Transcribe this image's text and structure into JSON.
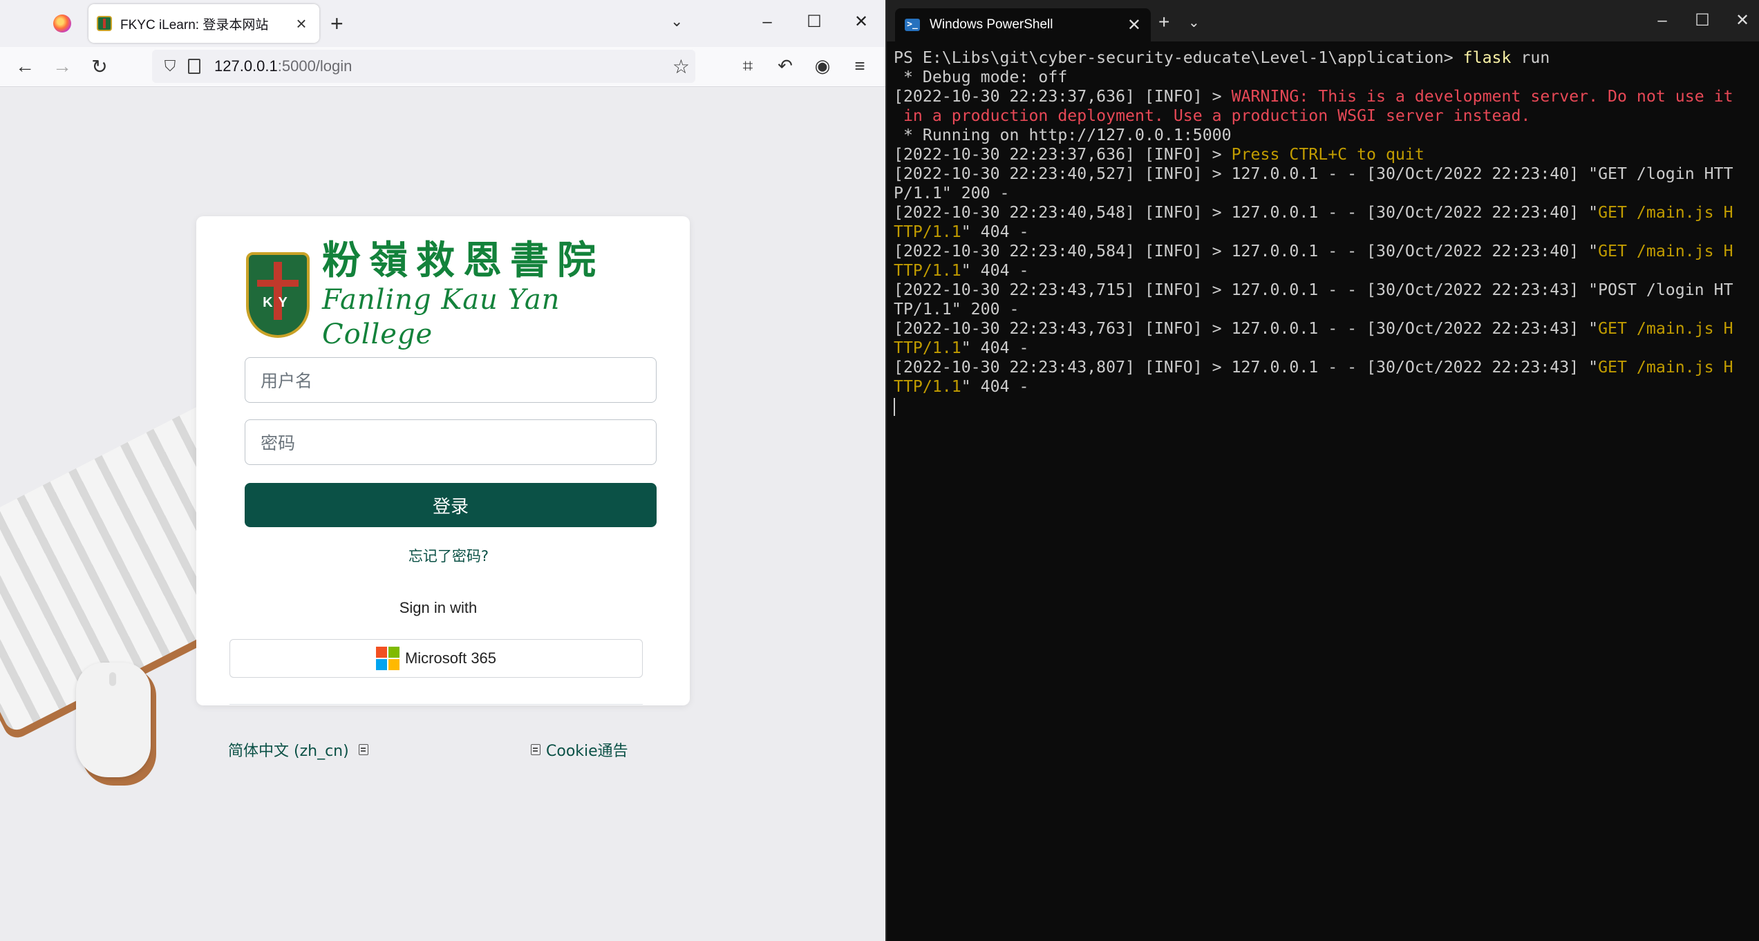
{
  "browser": {
    "active_tab_title": "FKYC iLearn: 登录本网站",
    "url_host": "127.0.0.1",
    "url_rest": ":5000/login"
  },
  "login": {
    "school_name_zh": "粉嶺救恩書院",
    "school_name_en": "Fanling Kau Yan College",
    "crest_letters": "KY",
    "username_placeholder": "用户名",
    "password_placeholder": "密码",
    "login_button": "登录",
    "forgot_password": "忘记了密码?",
    "sign_in_with": "Sign in with",
    "microsoft_button": "Microsoft 365",
    "language_link": "简体中文 (zh_cn)",
    "cookie_link": "Cookie通告"
  },
  "terminal": {
    "tab_title": "Windows PowerShell",
    "lines": [
      [
        {
          "t": "PS E:\\Libs\\git\\cyber-security-educate\\Level-1\\application> "
        },
        {
          "t": "flask",
          "c": "c-cmd"
        },
        {
          "t": " run"
        }
      ],
      [
        {
          "t": " * Debug mode: off"
        }
      ],
      [
        {
          "t": "[2022-10-30 22:23:37,636] [INFO] > "
        },
        {
          "t": "WARNING: This is a development server. Do not use it",
          "c": "c-red"
        }
      ],
      [
        {
          "t": " in a production deployment. Use a production WSGI server instead.",
          "c": "c-red"
        }
      ],
      [
        {
          "t": " * Running on http://127.0.0.1:5000"
        }
      ],
      [
        {
          "t": "[2022-10-30 22:23:37,636] [INFO] > "
        },
        {
          "t": "Press CTRL+C to quit",
          "c": "c-yellow"
        }
      ],
      [
        {
          "t": "[2022-10-30 22:23:40,527] [INFO] > 127.0.0.1 - - [30/Oct/2022 22:23:40] \"GET /login HTT"
        }
      ],
      [
        {
          "t": "P/1.1\" 200 -"
        }
      ],
      [
        {
          "t": "[2022-10-30 22:23:40,548] [INFO] > 127.0.0.1 - - [30/Oct/2022 22:23:40] \""
        },
        {
          "t": "GET /main.js H",
          "c": "c-yellow"
        }
      ],
      [
        {
          "t": "TTP/1.1",
          "c": "c-yellow"
        },
        {
          "t": "\" 404 -"
        }
      ],
      [
        {
          "t": "[2022-10-30 22:23:40,584] [INFO] > 127.0.0.1 - - [30/Oct/2022 22:23:40] \""
        },
        {
          "t": "GET /main.js H",
          "c": "c-yellow"
        }
      ],
      [
        {
          "t": "TTP/1.1",
          "c": "c-yellow"
        },
        {
          "t": "\" 404 -"
        }
      ],
      [
        {
          "t": "[2022-10-30 22:23:43,715] [INFO] > 127.0.0.1 - - [30/Oct/2022 22:23:43] \"POST /login HT"
        }
      ],
      [
        {
          "t": "TP/1.1\" 200 -"
        }
      ],
      [
        {
          "t": "[2022-10-30 22:23:43,763] [INFO] > 127.0.0.1 - - [30/Oct/2022 22:23:43] \""
        },
        {
          "t": "GET /main.js H",
          "c": "c-yellow"
        }
      ],
      [
        {
          "t": "TTP/1.1",
          "c": "c-yellow"
        },
        {
          "t": "\" 404 -"
        }
      ],
      [
        {
          "t": "[2022-10-30 22:23:43,807] [INFO] > 127.0.0.1 - - [30/Oct/2022 22:23:43] \""
        },
        {
          "t": "GET /main.js H",
          "c": "c-yellow"
        }
      ],
      [
        {
          "t": "TTP/1.1",
          "c": "c-yellow"
        },
        {
          "t": "\" 404 -"
        }
      ]
    ]
  },
  "colors": {
    "accent": "#0b5146",
    "school_green": "#13823b",
    "term_bg": "#0c0c0c",
    "term_warning": "#e74856",
    "term_highlight": "#c19c00"
  }
}
